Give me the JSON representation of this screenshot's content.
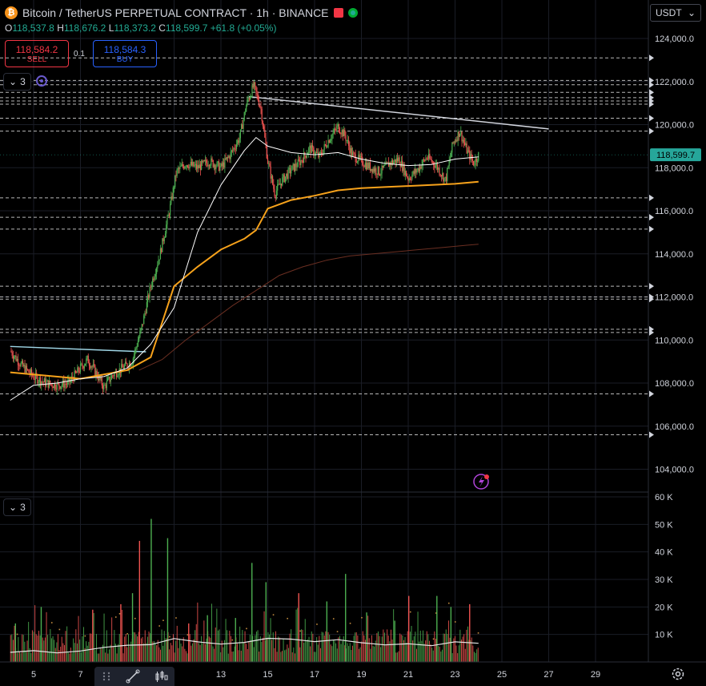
{
  "header": {
    "symbol_title": "Bitcoin / TetherUS PERPETUAL CONTRACT · 1h · BINANCE",
    "coin_glyph": "₿",
    "ohlc": {
      "o_label": "O",
      "o_value": "118,537.8",
      "h_label": "H",
      "h_value": "118,676.2",
      "l_label": "L",
      "l_value": "118,373.2",
      "c_label": "C",
      "c_value": "118,599.7",
      "change": "+61.8 (+0.05%)"
    }
  },
  "trade": {
    "sell_price": "118,584.2",
    "sell_label": "SELL",
    "buy_price": "118,584.3",
    "buy_label": "BUY",
    "spread": "0.1"
  },
  "indicators": {
    "main_count": "3",
    "volume_count": "3"
  },
  "currency_selector": "USDT",
  "last_price": "118,599.7",
  "chart_data": [
    {
      "type": "candlestick",
      "title": "Bitcoin / TetherUS PERPETUAL CONTRACT · 1h · BINANCE",
      "timeframe": "1h",
      "x_ticks": [
        "5",
        "7",
        "13",
        "15",
        "17",
        "19",
        "21",
        "23",
        "25",
        "27",
        "29"
      ],
      "x_tick_days": [
        5,
        7,
        13,
        15,
        17,
        19,
        21,
        23,
        25,
        27,
        29
      ],
      "y_ticks": [
        "104,000.0",
        "106,000.0",
        "108,000.0",
        "110,000.0",
        "112,000.0",
        "114,000.0",
        "116,000.0",
        "118,000.0",
        "120,000.0",
        "122,000.0",
        "124,000.0"
      ],
      "y_tick_values": [
        104000,
        106000,
        108000,
        110000,
        112000,
        114000,
        116000,
        118000,
        120000,
        122000,
        124000
      ],
      "ylim": [
        103000,
        125000
      ],
      "xlim_days": [
        4.0,
        31.0
      ],
      "close_path": [
        [
          4.0,
          109500
        ],
        [
          4.5,
          108800
        ],
        [
          5.0,
          108300
        ],
        [
          5.5,
          108000
        ],
        [
          6.0,
          107900
        ],
        [
          6.5,
          108000
        ],
        [
          7.0,
          108700
        ],
        [
          7.3,
          109100
        ],
        [
          7.6,
          108600
        ],
        [
          8.0,
          107800
        ],
        [
          8.4,
          108400
        ],
        [
          8.8,
          108700
        ],
        [
          9.2,
          109000
        ],
        [
          9.6,
          110500
        ],
        [
          10.0,
          112500
        ],
        [
          10.4,
          114000
        ],
        [
          10.8,
          116000
        ],
        [
          11.1,
          117800
        ],
        [
          11.5,
          118200
        ],
        [
          12.0,
          118000
        ],
        [
          12.5,
          118300
        ],
        [
          13.0,
          118000
        ],
        [
          13.4,
          118600
        ],
        [
          13.8,
          119400
        ],
        [
          14.1,
          121000
        ],
        [
          14.4,
          121800
        ],
        [
          14.7,
          120800
        ],
        [
          15.0,
          118300
        ],
        [
          15.3,
          116800
        ],
        [
          15.6,
          117400
        ],
        [
          16.0,
          117900
        ],
        [
          16.4,
          118300
        ],
        [
          16.8,
          118900
        ],
        [
          17.2,
          118500
        ],
        [
          17.6,
          119300
        ],
        [
          18.0,
          119900
        ],
        [
          18.3,
          119500
        ],
        [
          18.6,
          118600
        ],
        [
          19.0,
          118300
        ],
        [
          19.4,
          118000
        ],
        [
          19.8,
          117800
        ],
        [
          20.2,
          118200
        ],
        [
          20.6,
          118400
        ],
        [
          21.0,
          117500
        ],
        [
          21.4,
          117900
        ],
        [
          21.8,
          118500
        ],
        [
          22.2,
          118100
        ],
        [
          22.6,
          117400
        ],
        [
          22.9,
          119100
        ],
        [
          23.2,
          119700
        ],
        [
          23.5,
          118800
        ],
        [
          23.8,
          118200
        ],
        [
          24.0,
          118600
        ]
      ],
      "moving_averages": [
        {
          "color": "#f7a21b",
          "points": [
            [
              4.0,
              108500
            ],
            [
              7.0,
              108200
            ],
            [
              9.0,
              108600
            ],
            [
              10.0,
              109200
            ],
            [
              11.0,
              112500
            ],
            [
              12.0,
              113400
            ],
            [
              13.0,
              114200
            ],
            [
              14.0,
              114700
            ],
            [
              14.5,
              115100
            ],
            [
              15.0,
              116100
            ],
            [
              16.0,
              116500
            ],
            [
              17.0,
              116700
            ],
            [
              18.0,
              116950
            ],
            [
              19.0,
              117050
            ],
            [
              20.0,
              117100
            ],
            [
              21.0,
              117150
            ],
            [
              22.0,
              117200
            ],
            [
              23.0,
              117250
            ],
            [
              24.0,
              117350
            ]
          ]
        },
        {
          "color": "#ffffff",
          "points": [
            [
              4.0,
              107200
            ],
            [
              5.0,
              107900
            ],
            [
              6.0,
              108000
            ],
            [
              7.0,
              108200
            ],
            [
              8.0,
              108300
            ],
            [
              9.0,
              108700
            ],
            [
              10.0,
              109800
            ],
            [
              11.0,
              111500
            ],
            [
              12.0,
              115000
            ],
            [
              13.0,
              117200
            ],
            [
              14.0,
              118800
            ],
            [
              14.5,
              119400
            ],
            [
              15.0,
              119000
            ],
            [
              16.0,
              118700
            ],
            [
              17.0,
              118600
            ],
            [
              18.0,
              118700
            ],
            [
              19.0,
              118400
            ],
            [
              20.0,
              118200
            ],
            [
              21.0,
              118100
            ],
            [
              22.0,
              118150
            ],
            [
              23.0,
              118400
            ],
            [
              24.0,
              118500
            ]
          ]
        },
        {
          "color": "#6b2f22",
          "points": [
            [
              9.5,
              108600
            ],
            [
              10.5,
              109100
            ],
            [
              11.5,
              110000
            ],
            [
              12.5,
              110800
            ],
            [
              13.5,
              111600
            ],
            [
              14.5,
              112300
            ],
            [
              15.5,
              113000
            ],
            [
              16.5,
              113400
            ],
            [
              17.5,
              113700
            ],
            [
              18.5,
              113900
            ],
            [
              19.5,
              114000
            ],
            [
              20.5,
              114100
            ],
            [
              21.5,
              114200
            ],
            [
              22.5,
              114300
            ],
            [
              23.5,
              114400
            ],
            [
              24.0,
              114450
            ]
          ]
        }
      ],
      "trendlines": [
        {
          "color": "#9fd6e6",
          "from": [
            4.0,
            109700
          ],
          "to": [
            9.8,
            109450
          ]
        },
        {
          "color": "#d1d4dc",
          "from": [
            14.2,
            121300
          ],
          "to": [
            27.0,
            119800
          ]
        }
      ],
      "horizontal_levels": [
        107500,
        105600,
        110500,
        110350,
        111900,
        112000,
        112500,
        115150,
        115700,
        116600,
        119700,
        120300,
        120950,
        121100,
        121250,
        121500,
        121850,
        122050,
        123100
      ]
    },
    {
      "type": "volume",
      "y_ticks": [
        "10 K",
        "20 K",
        "30 K",
        "40 K",
        "50 K",
        "60 K"
      ],
      "y_tick_values": [
        10000,
        20000,
        30000,
        40000,
        50000,
        60000
      ],
      "ylim": [
        0,
        62000
      ],
      "spikes": [
        [
          10.0,
          52000
        ],
        [
          9.5,
          44000
        ],
        [
          10.7,
          45000
        ],
        [
          9.2,
          25000
        ],
        [
          8.7,
          21000
        ],
        [
          14.3,
          36000
        ],
        [
          14.9,
          29000
        ],
        [
          16.3,
          25000
        ],
        [
          18.3,
          32000
        ],
        [
          17.5,
          22000
        ],
        [
          21.0,
          24000
        ],
        [
          22.2,
          24000
        ],
        [
          22.8,
          20000
        ],
        [
          23.6,
          21000
        ],
        [
          20.4,
          15000
        ],
        [
          12.4,
          17000
        ],
        [
          11.6,
          14000
        ],
        [
          13.6,
          16000
        ],
        [
          5.3,
          20000
        ],
        [
          7.5,
          19000
        ],
        [
          19.2,
          18000
        ],
        [
          4.2,
          14000
        ]
      ],
      "ma_points": [
        [
          4.0,
          3500
        ],
        [
          5.0,
          4100
        ],
        [
          6.0,
          3300
        ],
        [
          7.0,
          4000
        ],
        [
          8.0,
          5300
        ],
        [
          9.0,
          6100
        ],
        [
          10.0,
          6300
        ],
        [
          11.0,
          8500
        ],
        [
          12.0,
          7300
        ],
        [
          13.0,
          6500
        ],
        [
          14.0,
          7100
        ],
        [
          15.0,
          8600
        ],
        [
          16.0,
          8300
        ],
        [
          17.0,
          7400
        ],
        [
          18.0,
          8100
        ],
        [
          19.0,
          7000
        ],
        [
          20.0,
          6200
        ],
        [
          21.0,
          6600
        ],
        [
          22.0,
          5900
        ],
        [
          23.0,
          7300
        ],
        [
          24.0,
          6800
        ]
      ]
    }
  ]
}
